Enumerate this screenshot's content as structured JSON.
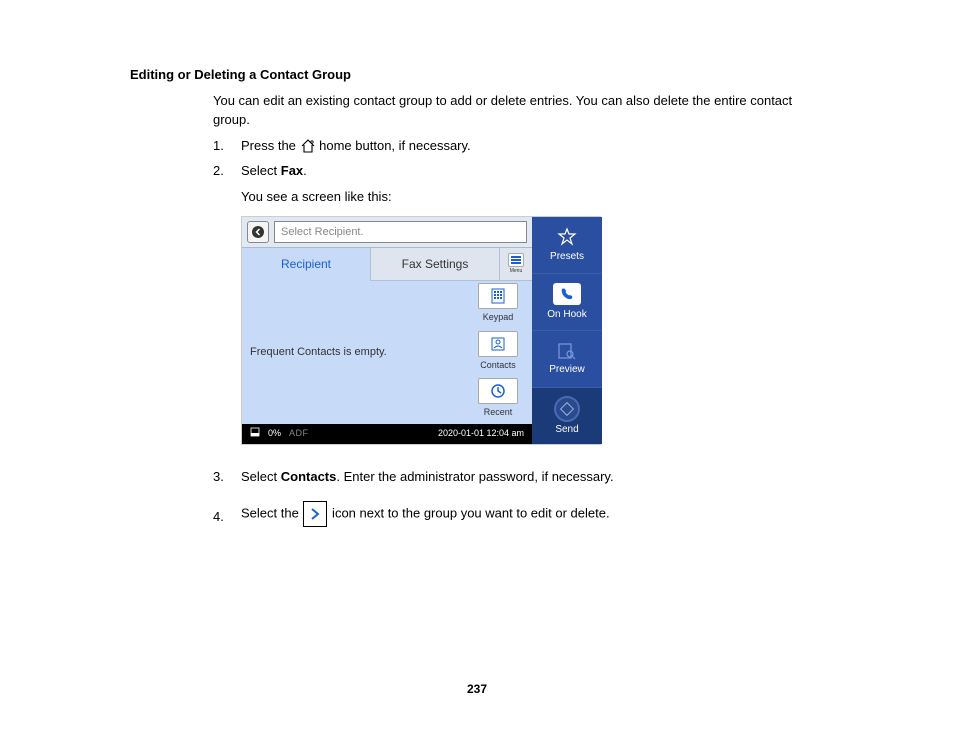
{
  "heading": "Editing or Deleting a Contact Group",
  "intro": "You can edit an existing contact group to add or delete entries. You can also delete the entire contact group.",
  "steps": {
    "s1a": "Press the ",
    "s1b": " home button, if necessary.",
    "s2a": "Select ",
    "s2b": "Fax",
    "s2c": ".",
    "s2sub": "You see a screen like this:",
    "s3a": "Select ",
    "s3b": "Contacts",
    "s3c": ". Enter the administrator password, if necessary.",
    "s4a": "Select the ",
    "s4b": " icon next to the group you want to edit or delete."
  },
  "nums": {
    "n1": "1.",
    "n2": "2.",
    "n3": "3.",
    "n4": "4."
  },
  "screen": {
    "placeholder": "Select Recipient.",
    "tab_recipient": "Recipient",
    "tab_fax_settings": "Fax Settings",
    "menu_label": "Menu",
    "frequent_empty": "Frequent Contacts is empty.",
    "keypad": "Keypad",
    "contacts": "Contacts",
    "recent": "Recent",
    "ink": "0%",
    "adf": "ADF",
    "datetime": "2020-01-01 12:04 am",
    "presets": "Presets",
    "on_hook": "On Hook",
    "preview": "Preview",
    "send": "Send"
  },
  "page_number": "237"
}
